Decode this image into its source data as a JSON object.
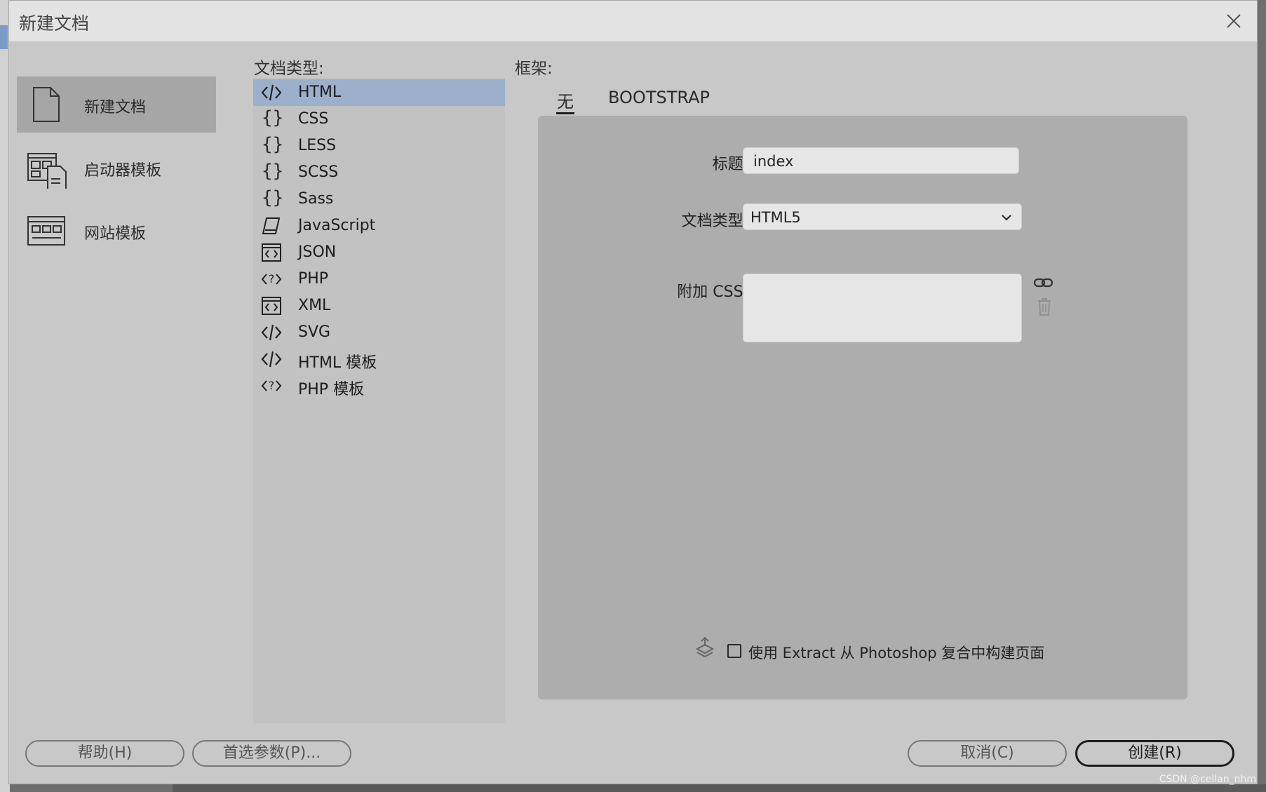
{
  "dialog": {
    "title": "新建文档"
  },
  "categories": [
    {
      "label": "新建文档",
      "icon": "document-icon",
      "selected": true
    },
    {
      "label": "启动器模板",
      "icon": "starter-template-icon",
      "selected": false
    },
    {
      "label": "网站模板",
      "icon": "site-template-icon",
      "selected": false
    }
  ],
  "doc_types_label": "文档类型:",
  "doc_types": [
    {
      "label": "HTML",
      "icon": "code-tag-icon",
      "selected": true
    },
    {
      "label": "CSS",
      "icon": "braces-icon"
    },
    {
      "label": "LESS",
      "icon": "braces-icon"
    },
    {
      "label": "SCSS",
      "icon": "braces-icon"
    },
    {
      "label": "Sass",
      "icon": "braces-icon"
    },
    {
      "label": "JavaScript",
      "icon": "script-scroll-icon"
    },
    {
      "label": "JSON",
      "icon": "boxed-code-icon"
    },
    {
      "label": "PHP",
      "icon": "php-tag-icon"
    },
    {
      "label": "XML",
      "icon": "boxed-code-icon"
    },
    {
      "label": "SVG",
      "icon": "code-tag-icon"
    },
    {
      "label": "HTML 模板",
      "icon": "code-tag-icon"
    },
    {
      "label": "PHP 模板",
      "icon": "php-tag-icon"
    }
  ],
  "framework": {
    "label": "框架:",
    "tabs": [
      {
        "label": "无",
        "active": true
      },
      {
        "label": "BOOTSTRAP",
        "active": false
      }
    ]
  },
  "form": {
    "title_label": "标题:",
    "title_value": "index",
    "doctype_label": "文档类型:",
    "doctype_value": "HTML5",
    "css_label": "附加 CSS:",
    "css_value": "",
    "extract_label": "使用 Extract 从 Photoshop 复合中构建页面",
    "extract_checked": false
  },
  "buttons": {
    "help": "帮助(H)",
    "prefs": "首选参数(P)...",
    "cancel": "取消(C)",
    "create": "创建(R)"
  },
  "watermark": "CSDN @cellan_nhm"
}
